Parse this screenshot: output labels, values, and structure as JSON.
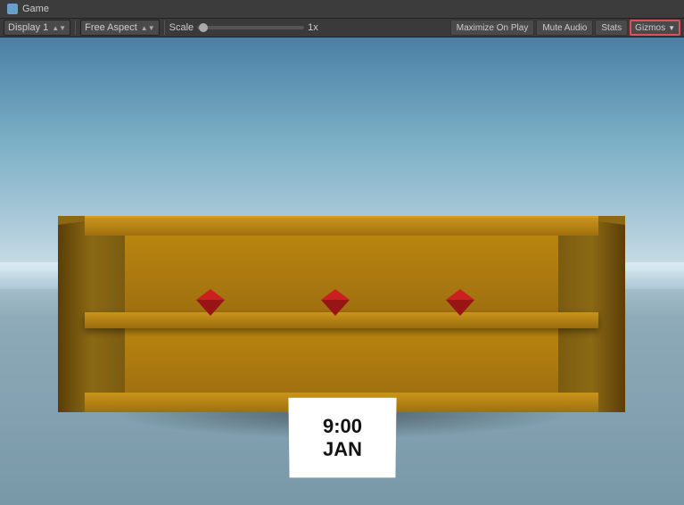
{
  "titlebar": {
    "title": "Game"
  },
  "toolbar": {
    "display_label": "Display 1",
    "aspect_label": "Free Aspect",
    "scale_label": "Scale",
    "scale_value": "1x",
    "maximize_label": "Maximize On Play",
    "mute_label": "Mute Audio",
    "stats_label": "Stats",
    "gizmos_label": "Gizmos"
  },
  "game": {
    "clock_time": "9:00",
    "clock_month": "JAN"
  },
  "gems": [
    {
      "id": "gem-1"
    },
    {
      "id": "gem-2"
    },
    {
      "id": "gem-3"
    }
  ]
}
